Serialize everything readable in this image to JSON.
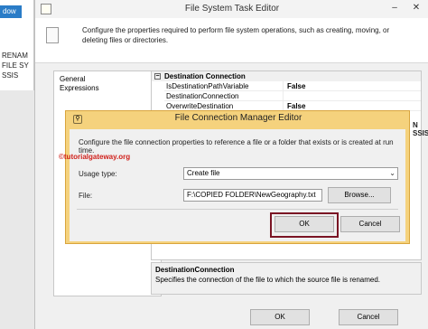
{
  "background": {
    "tab_label": "dow",
    "ssis_lines": [
      "RENAM",
      "FILE SY",
      "SSIS"
    ]
  },
  "fste": {
    "title": "File System Task Editor",
    "min_icon": "minimize-icon",
    "close_icon": "close-icon",
    "description": "Configure the properties required to perform file system operations, such as creating, moving, or deleting files or directories.",
    "nav": {
      "items": [
        "General",
        "Expressions"
      ]
    },
    "grid": {
      "category": "Destination Connection",
      "rows": [
        {
          "name": "IsDestinationPathVariable",
          "value": "False"
        },
        {
          "name": "DestinationConnection",
          "value": ""
        },
        {
          "name": "OverwriteDestination",
          "value": "False"
        }
      ],
      "partial_right_label": "N SSIS"
    },
    "help": {
      "title": "DestinationConnection",
      "text": "Specifies the connection of the file to which the source file is renamed."
    },
    "buttons": {
      "ok": "OK",
      "cancel": "Cancel"
    }
  },
  "dialog": {
    "title": "File Connection Manager Editor",
    "description": "Configure the file connection properties to reference a file or a folder that exists or is created at run time.",
    "watermark": "©tutorialgateway.org",
    "usage_type_label": "Usage type:",
    "usage_type_value": "Create file",
    "file_label": "File:",
    "file_value": "F:\\COPIED FOLDER\\NewGeography.txt",
    "browse": "Browse...",
    "ok": "OK",
    "cancel": "Cancel",
    "highlight_color": "#7a1424"
  }
}
